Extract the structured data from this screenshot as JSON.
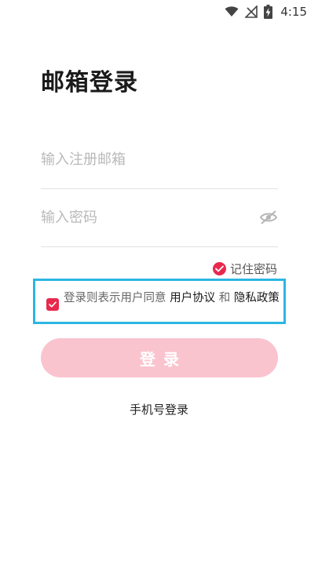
{
  "status_bar": {
    "time": "4:15",
    "icons": [
      "wifi-icon",
      "no-signal-icon",
      "battery-charging-icon"
    ]
  },
  "title": "邮箱登录",
  "email_field": {
    "placeholder": "输入注册邮箱",
    "value": ""
  },
  "password_field": {
    "placeholder": "输入密码",
    "value": "",
    "toggle_icon": "eye-hidden-icon"
  },
  "remember": {
    "label": "记住密码",
    "checked": true
  },
  "agreement": {
    "prefix": "登录则表示用户同意 ",
    "user_agreement": "用户协议",
    "conjunction": " 和 ",
    "privacy_policy": "隐私政策",
    "checked": true
  },
  "login_button": {
    "label": "登录"
  },
  "phone_login": {
    "label": "手机号登录"
  },
  "colors": {
    "accent": "#e8294d",
    "button_disabled": "#fac4cf",
    "highlight_border": "#2bb6e3"
  }
}
